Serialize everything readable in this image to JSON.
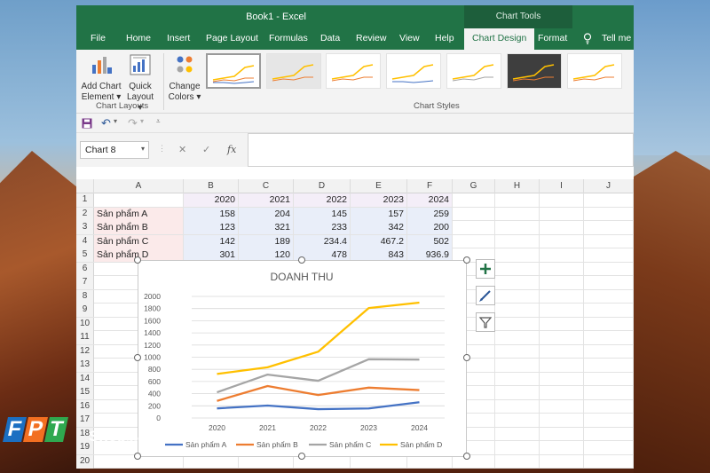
{
  "window": {
    "title": "Book1  -  Excel",
    "context_tab_group": "Chart Tools"
  },
  "tabs": [
    {
      "label": "File"
    },
    {
      "label": "Home"
    },
    {
      "label": "Insert"
    },
    {
      "label": "Page Layout"
    },
    {
      "label": "Formulas"
    },
    {
      "label": "Data"
    },
    {
      "label": "Review"
    },
    {
      "label": "View"
    },
    {
      "label": "Help"
    },
    {
      "label": "Chart Design"
    },
    {
      "label": "Format"
    }
  ],
  "tell_me": "Tell me w",
  "ribbon": {
    "add_chart_element": [
      "Add Chart",
      "Element"
    ],
    "quick_layout": [
      "Quick",
      "Layout"
    ],
    "change_colors": [
      "Change",
      "Colors"
    ],
    "chart_layouts_label": "Chart Layouts",
    "chart_styles_label": "Chart Styles"
  },
  "name_box": "Chart 8",
  "fx_label": "fx",
  "columns": [
    "A",
    "B",
    "C",
    "D",
    "E",
    "F",
    "G",
    "H",
    "I",
    "J"
  ],
  "sheet": {
    "header_row": [
      "",
      "2020",
      "2021",
      "2022",
      "2023",
      "2024"
    ],
    "rows": [
      [
        "Sản phẩm A",
        "158",
        "204",
        "145",
        "157",
        "259"
      ],
      [
        "Sản phẩm B",
        "123",
        "321",
        "233",
        "342",
        "200"
      ],
      [
        "Sản phẩm C",
        "142",
        "189",
        "234.4",
        "467.2",
        "502"
      ],
      [
        "Sản phẩm D",
        "301",
        "120",
        "478",
        "843",
        "936.9"
      ]
    ],
    "row_numbers": [
      "1",
      "2",
      "3",
      "4",
      "5",
      "6",
      "7",
      "8",
      "9",
      "10",
      "11",
      "12",
      "13",
      "14",
      "15",
      "16",
      "17",
      "18",
      "19",
      "20"
    ]
  },
  "chart_data": {
    "type": "line",
    "title": "DOANH THU",
    "categories": [
      "2020",
      "2021",
      "2022",
      "2023",
      "2024"
    ],
    "ylim": [
      0,
      2000
    ],
    "yticks": [
      0,
      200,
      400,
      600,
      800,
      1000,
      1200,
      1400,
      1600,
      1800,
      2000
    ],
    "grid": "horizontal",
    "legend": "bottom",
    "series": [
      {
        "name": "Sản phẩm A",
        "color": "#4472c4",
        "values": [
          158,
          204,
          145,
          157,
          259
        ]
      },
      {
        "name": "Sản phẩm B",
        "color": "#ed7d31",
        "values": [
          281,
          525,
          378,
          499,
          459
        ]
      },
      {
        "name": "Sản phẩm C",
        "color": "#a5a5a5",
        "values": [
          423,
          714,
          612,
          966,
          961
        ]
      },
      {
        "name": "Sản phẩm D",
        "color": "#ffc000",
        "values": [
          724,
          834,
          1090,
          1809,
          1898
        ]
      }
    ]
  },
  "watermark": {
    "brand": "FPT",
    "shop": "Shop",
    "domain": ".com.vn"
  }
}
